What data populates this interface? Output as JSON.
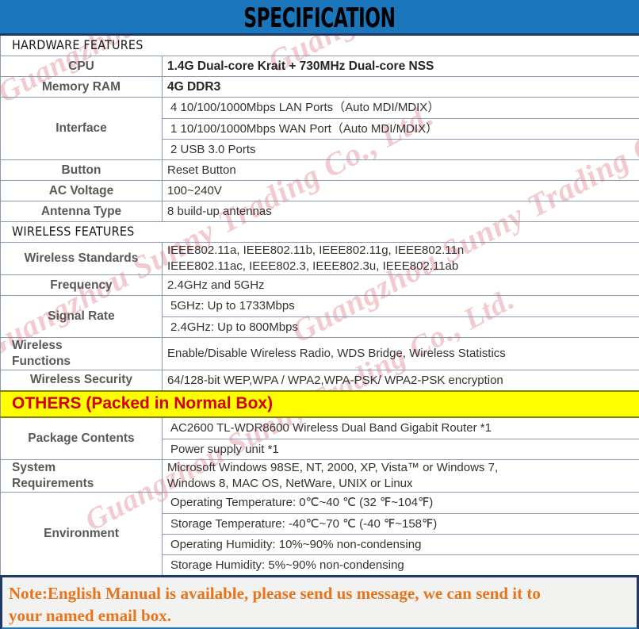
{
  "banner": {
    "title": "SPECIFICATION",
    "background_color": "#1b76bc"
  },
  "sections": {
    "hardware_title": "HARDWARE FEATURES",
    "wireless_title": "WIRELESS FEATURES",
    "others_title": "OTHERS (Packed in Normal Box)",
    "others_bg_color": "#ffff00",
    "others_text_color": "#d40000"
  },
  "hardware": {
    "cpu_label": "CPU",
    "cpu_value": "1.4G Dual-core Krait + 730MHz Dual-core NSS",
    "memory_label": "Memory RAM",
    "memory_value": "4G DDR3",
    "interface_label": "Interface",
    "interface_value_1": "4 10/100/1000Mbps LAN Ports（Auto MDI/MDIX）",
    "interface_value_2": "1 10/100/1000Mbps WAN Port（Auto MDI/MDIX）",
    "interface_value_3": "2 USB 3.0 Ports",
    "button_label": "Button",
    "button_value": "Reset Button",
    "ac_voltage_label": "AC Voltage",
    "ac_voltage_value": "100~240V",
    "antenna_label": "Antenna Type",
    "antenna_value": "8 build-up antennas"
  },
  "wireless": {
    "standards_label": "Wireless Standards",
    "standards_value_1": "IEEE802.11a, IEEE802.11b, IEEE802.11g, IEEE802.11n",
    "standards_value_2": "IEEE802.11ac, IEEE802.3, IEEE802.3u, IEEE802.11ab",
    "frequency_label": "Frequency",
    "frequency_value": "2.4GHz and 5GHz",
    "signal_rate_label": "Signal Rate",
    "signal_rate_value_1": "5GHz: Up to 1733Mbps",
    "signal_rate_value_2": "2.4GHz: Up to 800Mbps",
    "functions_label_1": "Wireless",
    "functions_label_2": "Functions",
    "functions_value": "Enable/Disable Wireless Radio, WDS Bridge, Wireless Statistics",
    "security_label": "Wireless Security",
    "security_value": "64/128-bit WEP,WPA / WPA2,WPA-PSK/ WPA2-PSK encryption"
  },
  "others": {
    "package_label": "Package Contents",
    "package_value_1": "AC2600 TL-WDR8600 Wireless Dual Band Gigabit Router *1",
    "package_value_2": "Power supply unit *1",
    "sysreq_label_1": "System",
    "sysreq_label_2": "Requirements",
    "sysreq_value_1": "Microsoft Windows 98SE, NT, 2000, XP, Vista™ or Windows 7,",
    "sysreq_value_2": "Windows 8, MAC OS, NetWare, UNIX or Linux",
    "environment_label": "Environment",
    "environment_value_1": "Operating Temperature: 0℃~40 ℃ (32 ℉~104℉)",
    "environment_value_2": "Storage Temperature: -40℃~70 ℃ (-40 ℉~158℉)",
    "environment_value_3": "Operating Humidity: 10%~90% non-condensing",
    "environment_value_4": "Storage Humidity: 5%~90% non-condensing"
  },
  "note": {
    "line_1": "Note:English Manual is available, please send us message, we can send it to",
    "line_2": "your named email box.",
    "text_color": "#e8741c"
  },
  "watermark": {
    "text": "Guangzhou Sunny Trading Co., Ltd.",
    "color": "#e8a0a8"
  }
}
